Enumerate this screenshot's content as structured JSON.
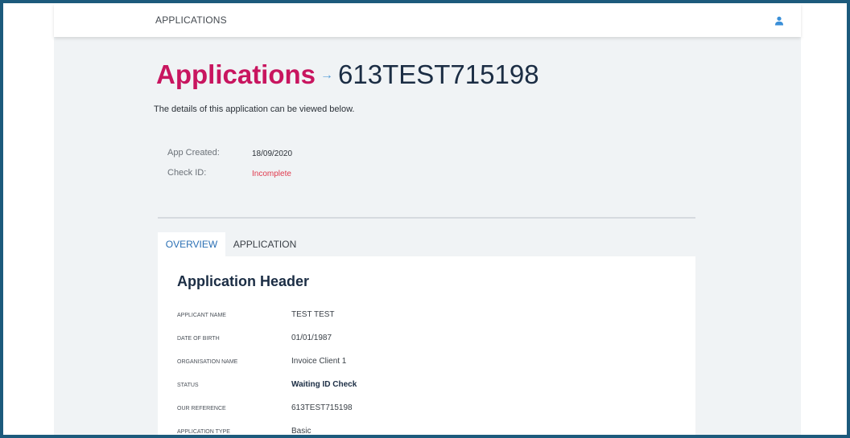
{
  "header": {
    "title": "APPLICATIONS",
    "user_icon": "user-icon"
  },
  "page": {
    "crumb": "Applications",
    "arrow": "→",
    "reference": "613TEST715198",
    "subtitle": "The details of this application can be viewed below."
  },
  "meta": {
    "app_created_label": "App Created:",
    "app_created_value": "18/09/2020",
    "check_id_label": "Check ID:",
    "check_id_value": "Incomplete"
  },
  "tabs": [
    {
      "label": "OVERVIEW",
      "active": true
    },
    {
      "label": "APPLICATION",
      "active": false
    }
  ],
  "panel": {
    "title": "Application Header",
    "rows": [
      {
        "label": "APPLICANT NAME",
        "value": "TEST TEST"
      },
      {
        "label": "DATE OF BIRTH",
        "value": "01/01/1987"
      },
      {
        "label": "ORGANISATION NAME",
        "value": "Invoice Client 1"
      },
      {
        "label": "STATUS",
        "value": "Waiting ID Check"
      },
      {
        "label": "OUR REFERENCE",
        "value": "613TEST715198"
      },
      {
        "label": "APPLICATION TYPE",
        "value": "Basic"
      }
    ]
  },
  "colors": {
    "accent": "#c8155f",
    "tab_active": "#2a6fb4",
    "error": "#e0394d",
    "frame": "#1c5a7c"
  }
}
